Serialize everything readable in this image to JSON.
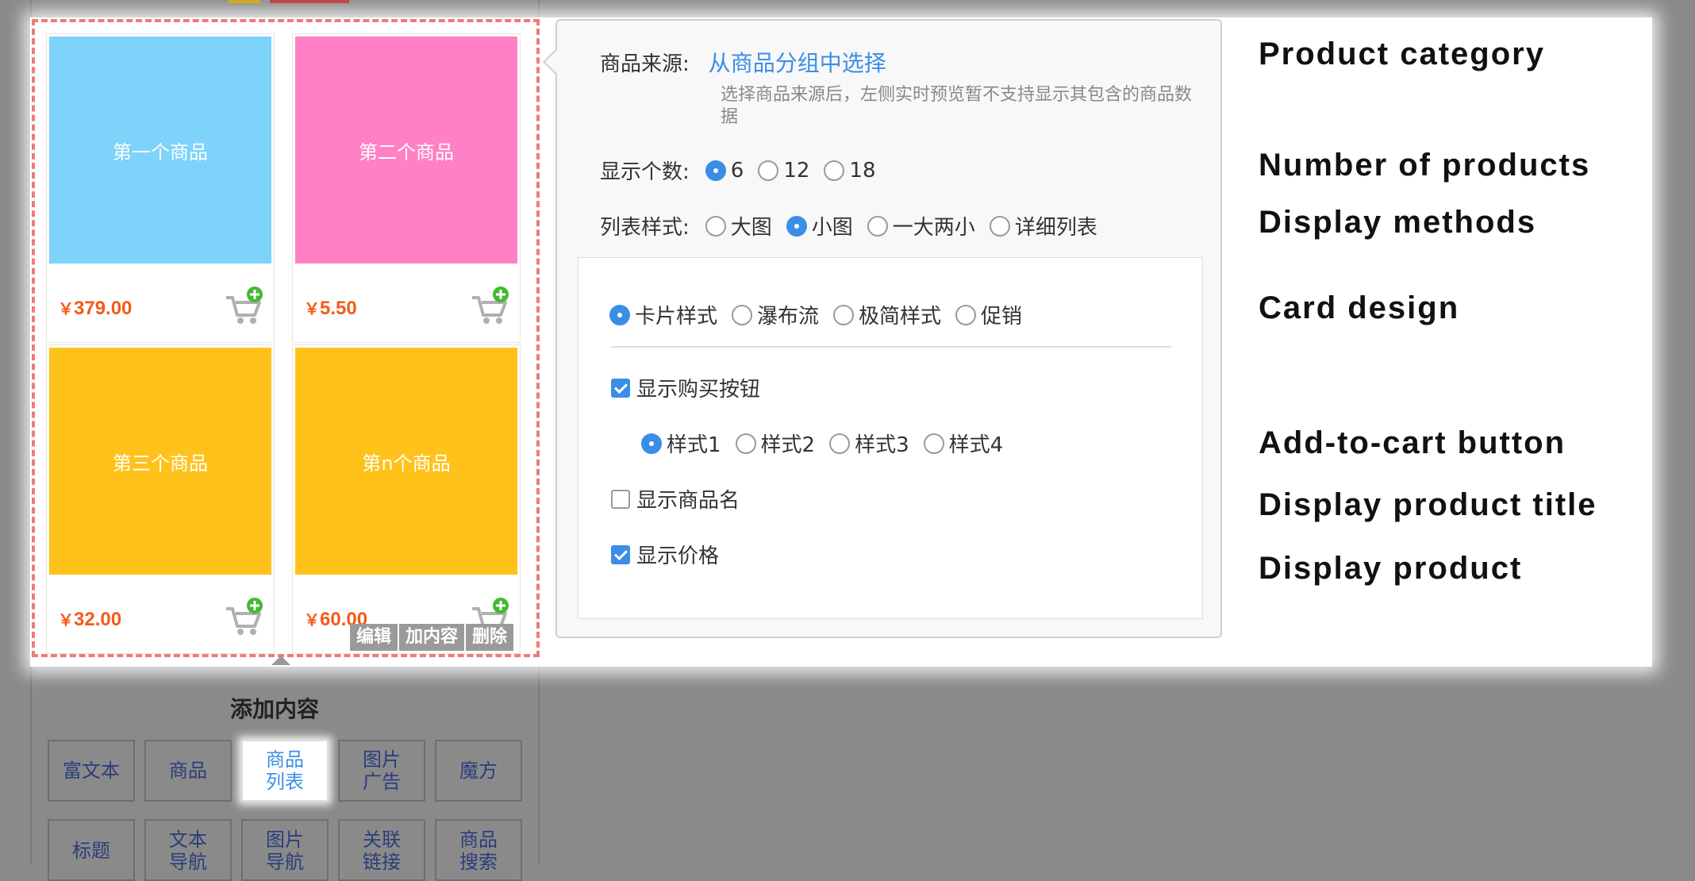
{
  "products": [
    {
      "name": "第一个商品",
      "price": "379.00",
      "color": "#7dd3fa"
    },
    {
      "name": "第二个商品",
      "price": "5.50",
      "color": "#ff80c5"
    },
    {
      "name": "第三个商品",
      "price": "32.00",
      "color": "#ffc21b"
    },
    {
      "name": "第n个商品",
      "price": "60.00",
      "color": "#ffc21b"
    }
  ],
  "currency": "￥",
  "component_actions": [
    "编辑",
    "加内容",
    "删除"
  ],
  "settings": {
    "source_label": "商品来源:",
    "source_value": "从商品分组中选择",
    "source_hint": "选择商品来源后，左侧实时预览暂不支持显示其包含的商品数据",
    "count_label": "显示个数:",
    "count_options": [
      "6",
      "12",
      "18"
    ],
    "count_selected": "6",
    "style_label": "列表样式:",
    "style_options": [
      "大图",
      "小图",
      "一大两小",
      "详细列表"
    ],
    "style_selected": "小图",
    "card_options": [
      "卡片样式",
      "瀑布流",
      "极简样式",
      "促销"
    ],
    "card_selected": "卡片样式",
    "show_buy_label": "显示购买按钮",
    "show_buy_checked": true,
    "buy_style_options": [
      "样式1",
      "样式2",
      "样式3",
      "样式4"
    ],
    "buy_style_selected": "样式1",
    "show_name_label": "显示商品名",
    "show_name_checked": false,
    "show_price_label": "显示价格",
    "show_price_checked": true
  },
  "annotations": {
    "category": "Product category",
    "number": "Number of products",
    "display": "Display methods",
    "card": "Card design",
    "cart": "Add-to-cart button",
    "title": "Display product title",
    "product": "Display product"
  },
  "add_content": {
    "title": "添加内容",
    "buttons_row1": [
      "富文本",
      "商品",
      "商品\n列表",
      "图片\n广告",
      "魔方"
    ],
    "buttons_row2": [
      "标题",
      "文本\n导航",
      "图片\n导航",
      "关联\n链接",
      "商品\n搜索"
    ],
    "active": "商品\n列表"
  },
  "colors": {
    "accent": "#3a8ee6",
    "price": "#f25a18",
    "dash": "#f07a7a"
  }
}
